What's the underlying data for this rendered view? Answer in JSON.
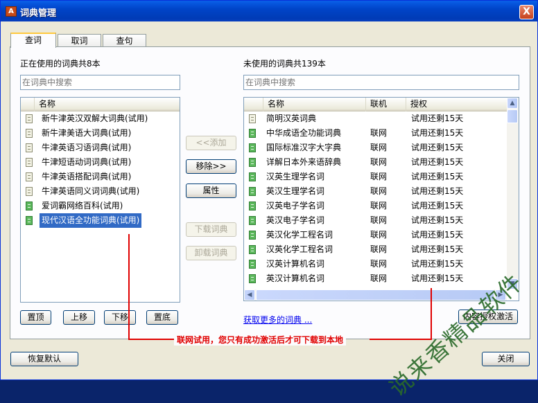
{
  "window": {
    "title": "词典管理",
    "icon_letter": "A",
    "close_symbol": "X"
  },
  "tabs": [
    {
      "label": "查词",
      "active": true
    },
    {
      "label": "取词",
      "active": false
    },
    {
      "label": "查句",
      "active": false
    }
  ],
  "left": {
    "heading": "正在使用的词典共8本",
    "search_placeholder": "在词典中搜索",
    "columns": [
      "名称"
    ],
    "items": [
      {
        "name": "新牛津英汉双解大词典(试用)",
        "icon": "dict-icon"
      },
      {
        "name": "新牛津美语大词典(试用)",
        "icon": "dict-icon"
      },
      {
        "name": "牛津英语习语词典(试用)",
        "icon": "dict-icon"
      },
      {
        "name": "牛津短语动词词典(试用)",
        "icon": "dict-icon"
      },
      {
        "name": "牛津英语搭配词典(试用)",
        "icon": "dict-icon"
      },
      {
        "name": "牛津英语同义词词典(试用)",
        "icon": "dict-icon"
      },
      {
        "name": "爱词霸网络百科(试用)",
        "icon": "online-dict-icon"
      },
      {
        "name": "现代汉语全功能词典(试用)",
        "icon": "online-dict-icon",
        "selected": true
      }
    ],
    "buttons": {
      "top": "置顶",
      "up": "上移",
      "down": "下移",
      "bottom": "置底"
    }
  },
  "middle": {
    "add": "<<添加",
    "remove": "移除>>",
    "properties": "属性",
    "download": "下载词典",
    "uninstall": "卸载词典"
  },
  "right": {
    "heading": "未使用的词典共139本",
    "search_placeholder": "在词典中搜索",
    "columns": [
      "名称",
      "联机",
      "授权"
    ],
    "items": [
      {
        "name": "简明汉英词典",
        "online": "",
        "auth": "试用还剩15天",
        "icon": "dict-icon"
      },
      {
        "name": "中华成语全功能词典",
        "online": "联网",
        "auth": "试用还剩15天",
        "icon": "online-dict-icon"
      },
      {
        "name": "国际标准汉字大字典",
        "online": "联网",
        "auth": "试用还剩15天",
        "icon": "online-dict-icon"
      },
      {
        "name": "详解日本外来语辞典",
        "online": "联网",
        "auth": "试用还剩15天",
        "icon": "online-dict-icon"
      },
      {
        "name": "汉英生理学名词",
        "online": "联网",
        "auth": "试用还剩15天",
        "icon": "online-dict-icon"
      },
      {
        "name": "英汉生理学名词",
        "online": "联网",
        "auth": "试用还剩15天",
        "icon": "online-dict-icon"
      },
      {
        "name": "汉英电子学名词",
        "online": "联网",
        "auth": "试用还剩15天",
        "icon": "online-dict-icon"
      },
      {
        "name": "英汉电子学名词",
        "online": "联网",
        "auth": "试用还剩15天",
        "icon": "online-dict-icon"
      },
      {
        "name": "英汉化学工程名词",
        "online": "联网",
        "auth": "试用还剩15天",
        "icon": "online-dict-icon"
      },
      {
        "name": "汉英化学工程名词",
        "online": "联网",
        "auth": "试用还剩15天",
        "icon": "online-dict-icon"
      },
      {
        "name": "汉英计算机名词",
        "online": "联网",
        "auth": "试用还剩15天",
        "icon": "online-dict-icon"
      },
      {
        "name": "英汉计算机名词",
        "online": "联网",
        "auth": "试用还剩15天",
        "icon": "online-dict-icon"
      }
    ],
    "more_link": "获取更多的词典 ...",
    "activate_button": "内容授权激活"
  },
  "annotation": "联网试用，您只有成功激活后才可下载到本地",
  "watermark": "说来香精品软件",
  "footer": {
    "restore": "恢复默认",
    "close": "关闭"
  },
  "scroll": {
    "up_symbol": "▲",
    "down_symbol": "▼",
    "left_symbol": "◀",
    "right_symbol": "▶"
  }
}
